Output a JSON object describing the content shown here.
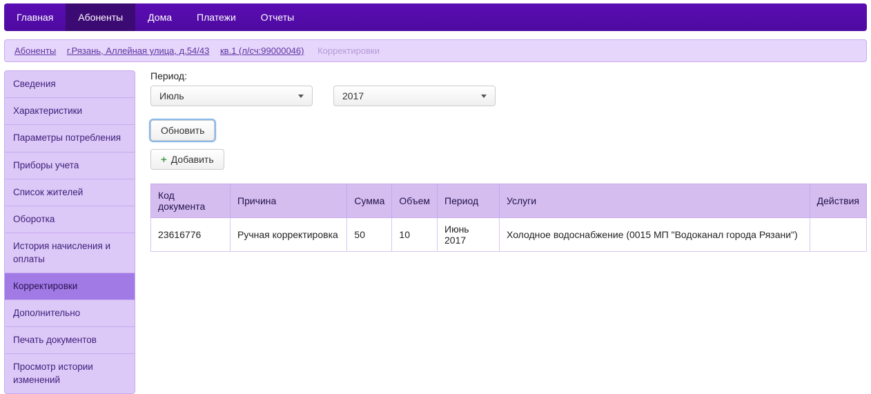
{
  "topnav": {
    "tabs": [
      {
        "label": "Главная"
      },
      {
        "label": "Абоненты"
      },
      {
        "label": "Дома"
      },
      {
        "label": "Платежи"
      },
      {
        "label": "Отчеты"
      }
    ],
    "active_index": 1
  },
  "breadcrumb": {
    "links": [
      "Абоненты",
      "г.Рязань, Аллейная улица, д.54/43",
      " кв.1 (л/сч:99000046)"
    ],
    "current": "Корректировки"
  },
  "sidebar": {
    "items": [
      "Сведения",
      "Характеристики",
      "Параметры потребления",
      "Приборы учета",
      "Список жителей",
      "Оборотка",
      "История начисления и оплаты",
      "Корректировки",
      "Дополнительно",
      "Печать документов",
      "Просмотр истории изменений"
    ],
    "active_index": 7
  },
  "filter": {
    "label": "Период:",
    "month": "Июль",
    "year": "2017",
    "refresh_label": "Обновить",
    "add_label": "Добавить"
  },
  "table": {
    "columns": [
      "Код документа",
      "Причина",
      "Сумма",
      "Объем",
      "Период",
      "Услуги",
      "Действия"
    ],
    "rows": [
      {
        "code": "23616776",
        "reason": "Ручная корректировка",
        "sum": "50",
        "volume": "10",
        "period": "Июнь 2017",
        "service": "Холодное водоснабжение (0015 МП \"Водоканал города Рязани\")",
        "actions": ""
      }
    ]
  }
}
